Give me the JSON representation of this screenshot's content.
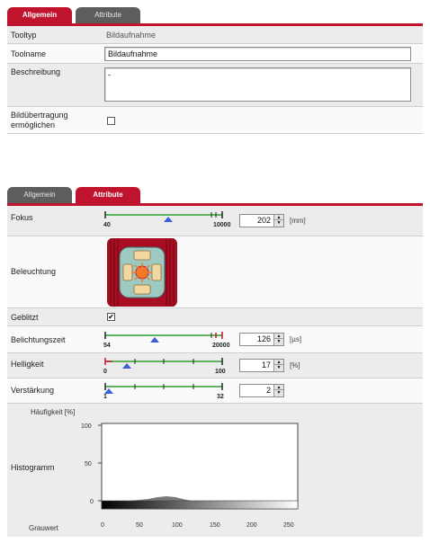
{
  "panel1": {
    "tabs": [
      {
        "label": "Allgemein",
        "active": true
      },
      {
        "label": "Attribute",
        "active": false
      }
    ],
    "rows": {
      "tooltyp": {
        "label": "Tooltyp",
        "value": "Bildaufnahme"
      },
      "toolname": {
        "label": "Toolname",
        "value": "Bildaufnahme"
      },
      "beschreibung": {
        "label": "Beschreibung",
        "value": "-"
      },
      "bilduebertragung": {
        "label_line1": "Bildübertragung",
        "label_line2": "ermöglichen",
        "checked": false
      }
    }
  },
  "panel2": {
    "tabs": [
      {
        "label": "Allgemein",
        "active": false
      },
      {
        "label": "Attribute",
        "active": true
      }
    ],
    "fokus": {
      "label": "Fokus",
      "min": "40",
      "max": "10000",
      "value": "202",
      "unit": "[mm]"
    },
    "beleuchtung": {
      "label": "Beleuchtung"
    },
    "geblitzt": {
      "label": "Geblitzt",
      "checked": true
    },
    "belichtungszeit": {
      "label": "Belichtungszeit",
      "min": "54",
      "max": "20000",
      "value": "126",
      "unit": "[µs]"
    },
    "helligkeit": {
      "label": "Helligkeit",
      "min": "0",
      "max": "100",
      "value": "17",
      "unit": "[%]"
    },
    "verstaerkung": {
      "label": "Verstärkung",
      "min": "1",
      "max": "32",
      "value": "2"
    },
    "histogram": {
      "ylabel": "Häufigkeit [%]",
      "row_label": "Histogramm",
      "xlabel": "Grauwert",
      "y_ticks": [
        "100",
        "50",
        "0"
      ],
      "x_ticks": [
        "0",
        "50",
        "100",
        "150",
        "200",
        "250"
      ]
    }
  },
  "colors": {
    "accent": "#c0142e",
    "tab_inactive": "#5d5d5d",
    "slider_line": "#2ca02c",
    "slider_thumb": "#3a5fd8"
  }
}
